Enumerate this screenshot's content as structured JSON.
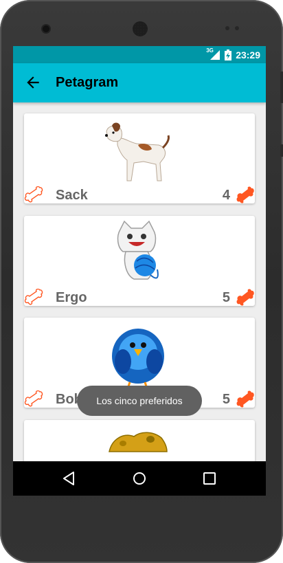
{
  "status": {
    "network": "3G",
    "time": "23:29"
  },
  "appbar": {
    "title": "Petagram"
  },
  "pets": [
    {
      "name": "Sack",
      "rating": "4"
    },
    {
      "name": "Ergo",
      "rating": "5"
    },
    {
      "name": "Bob",
      "rating": "5"
    }
  ],
  "toast": {
    "text": "Los cinco preferidos"
  },
  "colors": {
    "status": "#0097a7",
    "appbar": "#00bcd4",
    "bone": "#ff5722"
  },
  "icons": [
    "back-arrow-icon",
    "bone-outline-icon",
    "bone-filled-icon",
    "nav-back-icon",
    "nav-home-icon",
    "nav-recents-icon"
  ]
}
